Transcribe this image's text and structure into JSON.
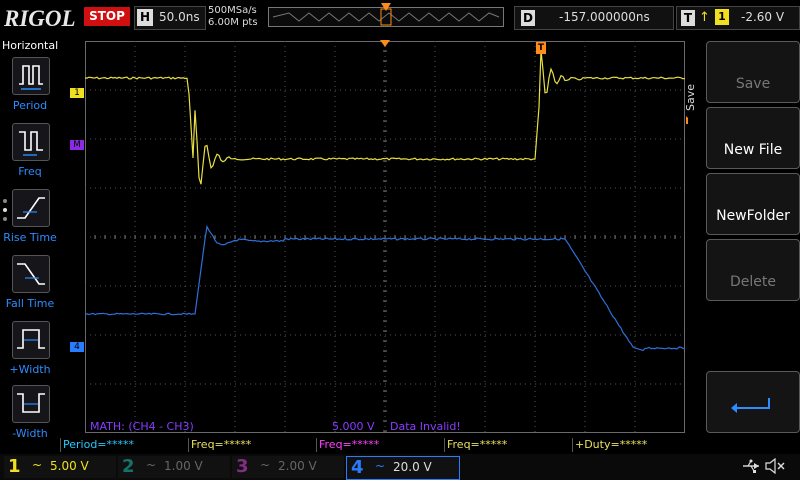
{
  "header": {
    "logo": "RIGOL",
    "run_status": "STOP",
    "timebase_letter": "H",
    "timebase_value": "50.0ns",
    "sample_rate": "500MSa/s",
    "memory_depth": "6.00M pts",
    "delay_letter": "D",
    "delay_value": "-157.000000ns",
    "trigger_letter": "T",
    "trigger_level": "-2.60 V"
  },
  "left_menu": {
    "title": "Horizontal",
    "items": [
      {
        "label": "Period",
        "icon": "period-icon"
      },
      {
        "label": "Freq",
        "icon": "freq-icon"
      },
      {
        "label": "Rise Time",
        "icon": "rise-time-icon"
      },
      {
        "label": "Fall Time",
        "icon": "fall-time-icon"
      },
      {
        "label": "+Width",
        "icon": "positive-width-icon"
      },
      {
        "label": "-Width",
        "icon": "negative-width-icon"
      }
    ]
  },
  "right_menu": {
    "tag": "Save",
    "buttons": [
      {
        "label": "Save",
        "enabled": false
      },
      {
        "label": "New File",
        "enabled": true
      },
      {
        "label": "NewFolder",
        "enabled": true
      },
      {
        "label": "Delete",
        "enabled": false
      },
      {
        "label": "",
        "icon": "return-icon",
        "enabled": true
      }
    ]
  },
  "screen": {
    "marker_ch1": "1",
    "marker_math": "M",
    "marker_ch4": "4",
    "trigger_marker": "T",
    "math_label": "MATH: (CH4 - CH3)",
    "math_scale": "5.000 V",
    "math_status": "Data Invalid!"
  },
  "measurements": [
    {
      "label": "Period=*****",
      "color": "#28c8ff"
    },
    {
      "label": "Freq=*****",
      "color": "#e8e060"
    },
    {
      "label": "Freq=*****",
      "color": "#ff40ff"
    },
    {
      "label": "Freq=*****",
      "color": "#e8e060"
    },
    {
      "label": "+Duty=*****",
      "color": "#e8e060"
    }
  ],
  "channels": [
    {
      "num": "1",
      "coupling": "~",
      "scale": "5.00 V",
      "color": "#f0e020",
      "active": true
    },
    {
      "num": "2",
      "coupling": "~",
      "scale": "1.00 V",
      "color": "#19b3a0",
      "active": false
    },
    {
      "num": "3",
      "coupling": "~",
      "scale": "2.00 V",
      "color": "#d040d0",
      "active": false
    },
    {
      "num": "4",
      "coupling": "~",
      "scale": "20.0 V",
      "color": "#2a7cff",
      "active": true
    }
  ],
  "colors": {
    "ch1": "#e8e040",
    "ch4": "#2f6fd8",
    "math": "#9a40ff",
    "accent": "#2d8cff",
    "trigger": "#ff8c1a"
  }
}
